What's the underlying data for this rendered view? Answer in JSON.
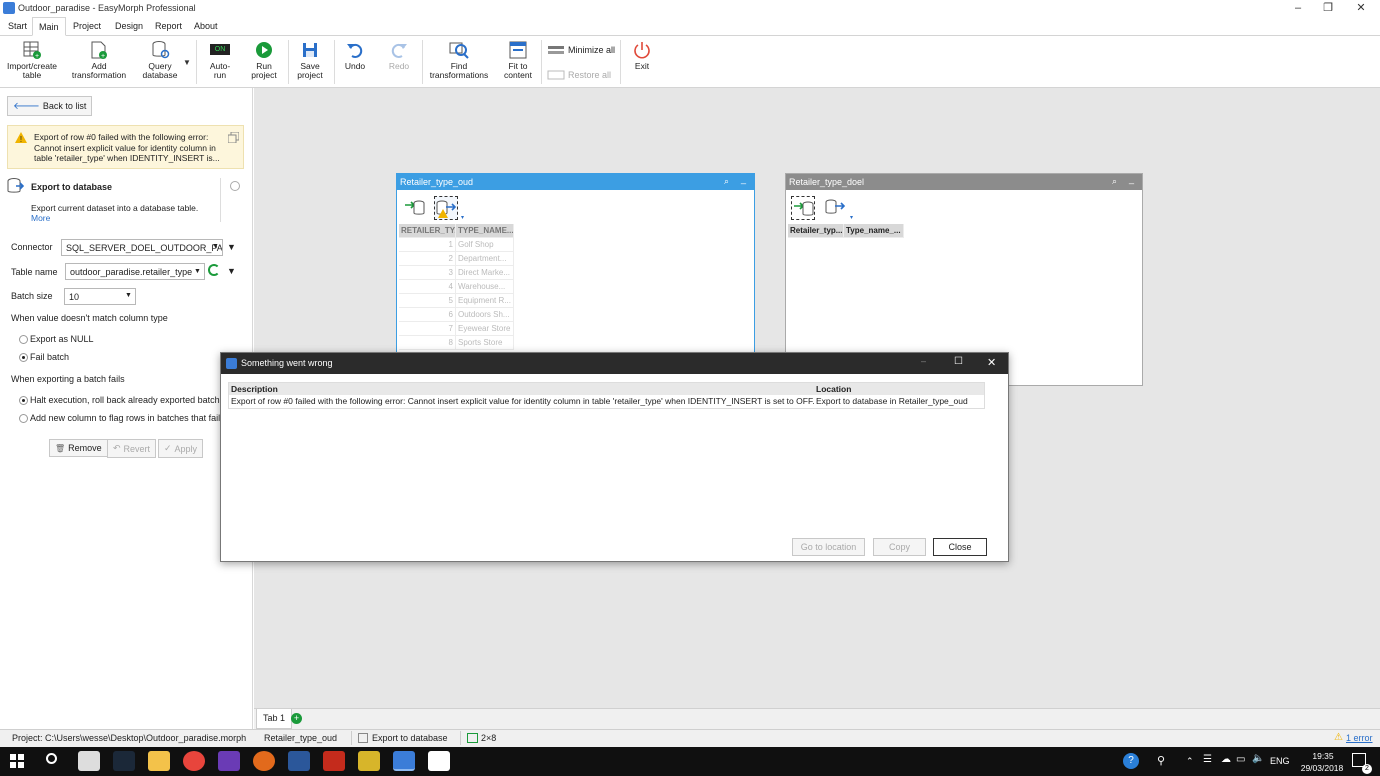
{
  "window": {
    "title": "Outdoor_paradise - EasyMorph Professional",
    "controls": {
      "minimize": "–",
      "restore": "❐",
      "close": "✕"
    }
  },
  "menu_tabs": [
    "Start",
    "Main",
    "Project",
    "Design",
    "Report",
    "About"
  ],
  "ribbon": {
    "import": "Import/create\ntable",
    "add": "Add\ntransformation",
    "query": "Query\ndatabase",
    "autorun": "Auto-\nrun",
    "autorun_badge": "ON",
    "run": "Run\nproject",
    "save": "Save\nproject",
    "undo": "Undo",
    "redo": "Redo",
    "find": "Find\ntransformations",
    "fit": "Fit to\ncontent",
    "minimize_all": "Minimize all",
    "restore_all": "Restore all",
    "exit": "Exit"
  },
  "left": {
    "back": "Back to list",
    "error_text": "Export of row #0 failed with the following error: Cannot insert explicit value for identity column in table 'retailer_type' when IDENTITY_INSERT is...",
    "action_title": "Export to database",
    "action_desc": "Export current dataset into a database table.",
    "more": "More",
    "connector_label": "Connector",
    "connector_value": "SQL_SERVER_DOEL_OUTDOOR_PAR...",
    "table_label": "Table name",
    "table_value": "outdoor_paradise.retailer_type",
    "batch_label": "Batch size",
    "batch_value": "10",
    "mismatch_label": "When value doesn't match column type",
    "opt_null": "Export as NULL",
    "opt_fail": "Fail batch",
    "batchfail_label": "When exporting a batch fails",
    "opt_halt": "Halt execution, roll back already exported batches",
    "opt_flag": "Add new column to flag rows in batches that failed",
    "remove": "Remove",
    "revert": "Revert",
    "apply": "Apply"
  },
  "table_oud": {
    "title": "Retailer_type_oud",
    "columns": [
      "RETAILER_TY...",
      "TYPE_NAME..."
    ],
    "rows": [
      [
        "1",
        "Golf Shop"
      ],
      [
        "2",
        "Department..."
      ],
      [
        "3",
        "Direct Marke..."
      ],
      [
        "4",
        "Warehouse..."
      ],
      [
        "5",
        "Equipment R..."
      ],
      [
        "6",
        "Outdoors Sh..."
      ],
      [
        "7",
        "Eyewear Store"
      ],
      [
        "8",
        "Sports Store"
      ]
    ]
  },
  "table_doel": {
    "title": "Retailer_type_doel",
    "columns": [
      "Retailer_typ...",
      "Type_name_..."
    ]
  },
  "dialog": {
    "title": "Something went wrong",
    "col_description": "Description",
    "col_location": "Location",
    "row_description": "Export of row #0 failed with the following error: Cannot insert explicit value for identity column in table 'retailer_type' when IDENTITY_INSERT is set to OFF.",
    "row_location": "Export to database in Retailer_type_oud",
    "go_to_location": "Go to location",
    "copy": "Copy",
    "close": "Close"
  },
  "bottom_tabs": {
    "tab1": "Tab 1",
    "add": "+"
  },
  "status": {
    "project": "Project: C:\\Users\\wesse\\Desktop\\Outdoor_paradise.morph",
    "table": "Retailer_type_oud",
    "transform": "Export to database",
    "size": "2×8",
    "errors": "1 error"
  },
  "taskbar": {
    "lang": "ENG",
    "time": "19:35",
    "date": "29/03/2018",
    "notifications": "2"
  },
  "colors": {
    "active_header": "#3c9ee3",
    "inactive_header": "#8c8c8c",
    "warning_bg": "#fdf6dc",
    "dialog_header": "#2b2b2b"
  }
}
